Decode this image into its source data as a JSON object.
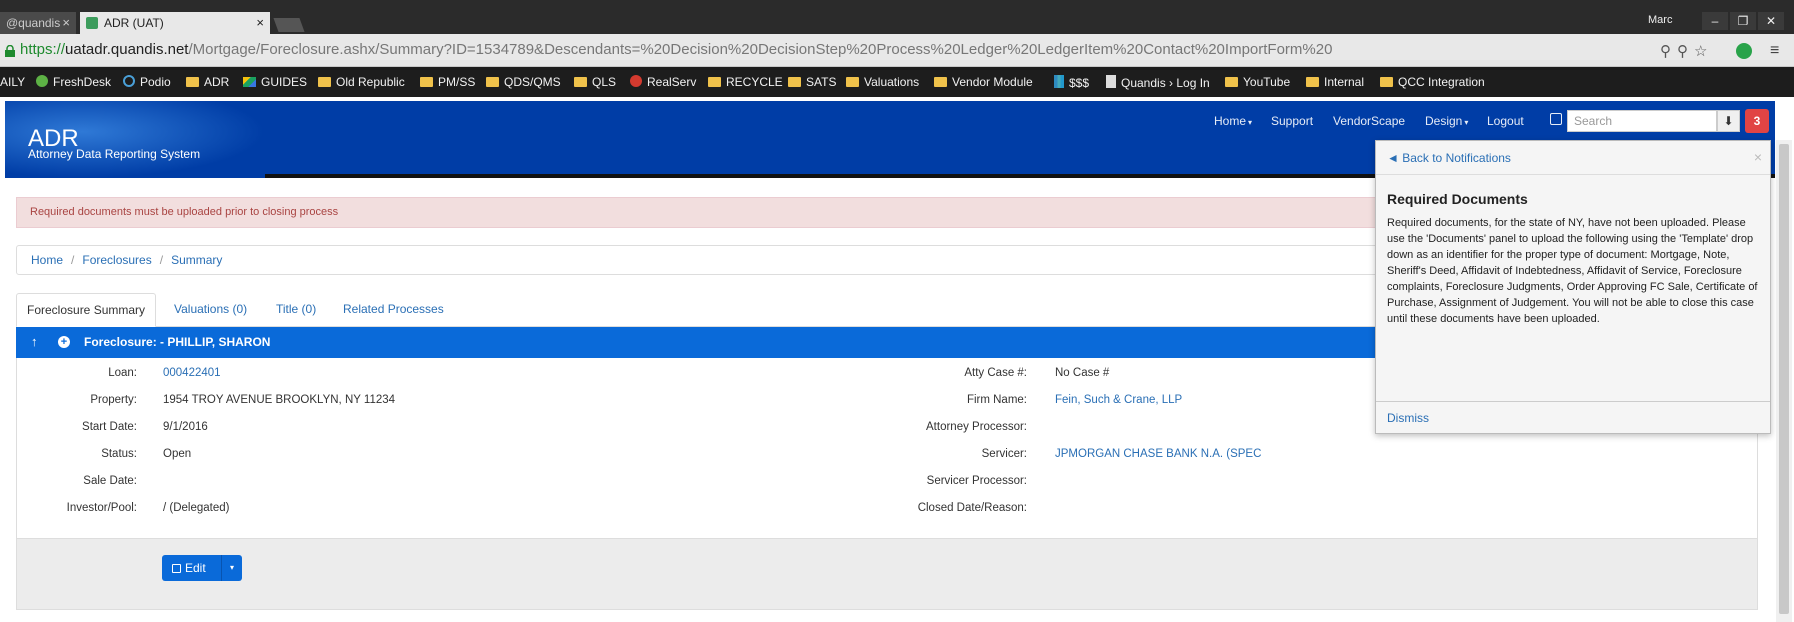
{
  "browser": {
    "tabs": [
      {
        "label": "@quandis",
        "close": "×"
      },
      {
        "label": "ADR (UAT)",
        "close": "×"
      }
    ],
    "user": "Marc",
    "window_controls": [
      "–",
      "❐",
      "✕"
    ],
    "url": {
      "scheme": "https://",
      "host": "uatadr.quandis.net",
      "path": "/Mortgage/Foreclosure.ashx/Summary?ID=1534789&Descendants=%20Decision%20DecisionStep%20Process%20Ledger%20LedgerItem%20Contact%20ImportForm%20"
    },
    "bookmarks": [
      "AILY",
      "FreshDesk",
      "Podio",
      "ADR",
      "GUIDES",
      "Old Republic",
      "PM/SS",
      "QDS/QMS",
      "QLS",
      "RealServ",
      "RECYCLE",
      "SATS",
      "Valuations",
      "Vendor Module",
      "$$$",
      "Quandis › Log In",
      "YouTube",
      "Internal",
      "QCC Integration"
    ]
  },
  "app": {
    "brand": "ADR",
    "subtitle": "Attorney Data Reporting System",
    "nav": [
      "Home",
      "Support",
      "VendorScape",
      "Design",
      "Logout"
    ],
    "search_placeholder": "Search",
    "notification_count": "3"
  },
  "alert": "Required documents must be uploaded prior to closing process",
  "breadcrumb": [
    "Home",
    "Foreclosures",
    "Summary"
  ],
  "tabs": [
    "Foreclosure Summary",
    "Valuations (0)",
    "Title (0)",
    "Related Processes"
  ],
  "panel": {
    "title": "Foreclosure: - PHILLIP, SHARON",
    "left": [
      {
        "label": "Loan:",
        "value": "000422401"
      },
      {
        "label": "Property:",
        "value": "1954 TROY AVENUE BROOKLYN, NY 11234"
      },
      {
        "label": "Start Date:",
        "value": "9/1/2016"
      },
      {
        "label": "Status:",
        "value": "Open"
      },
      {
        "label": "Sale Date:",
        "value": ""
      },
      {
        "label": "Investor/Pool:",
        "value": "/ (Delegated)"
      }
    ],
    "right": [
      {
        "label": "Atty Case #:",
        "value": "No Case #"
      },
      {
        "label": "Firm Name:",
        "value": "Fein, Such & Crane, LLP"
      },
      {
        "label": "Attorney Processor:",
        "value": ""
      },
      {
        "label": "Servicer:",
        "value": "JPMORGAN CHASE BANK N.A. (SPEC"
      },
      {
        "label": "Servicer Processor:",
        "value": ""
      },
      {
        "label": "Closed Date/Reason:",
        "value": ""
      }
    ],
    "edit_label": "Edit"
  },
  "notification": {
    "back": "◄ Back to Notifications",
    "close": "×",
    "title": "Required Documents",
    "body": "Required documents, for the state of NY, have not been uploaded. Please use the 'Documents' panel to upload the following using the 'Template' drop down as an identifier for the proper type of document: Mortgage, Note, Sheriff's Deed, Affidavit of Indebtedness, Affidavit of Service, Foreclosure complaints, Foreclosure Judgments, Order Approving FC Sale, Certificate of Purchase, Assignment of Judgement. You will not be able to close this case until these documents have been uploaded.",
    "dismiss": "Dismiss"
  },
  "colors": {
    "header_blue": "#003da6",
    "panel_blue": "#0a6ad9",
    "link": "#2a6fb5",
    "alert_bg": "#f2dede",
    "alert_text": "#a94442",
    "badge": "#e14444"
  }
}
